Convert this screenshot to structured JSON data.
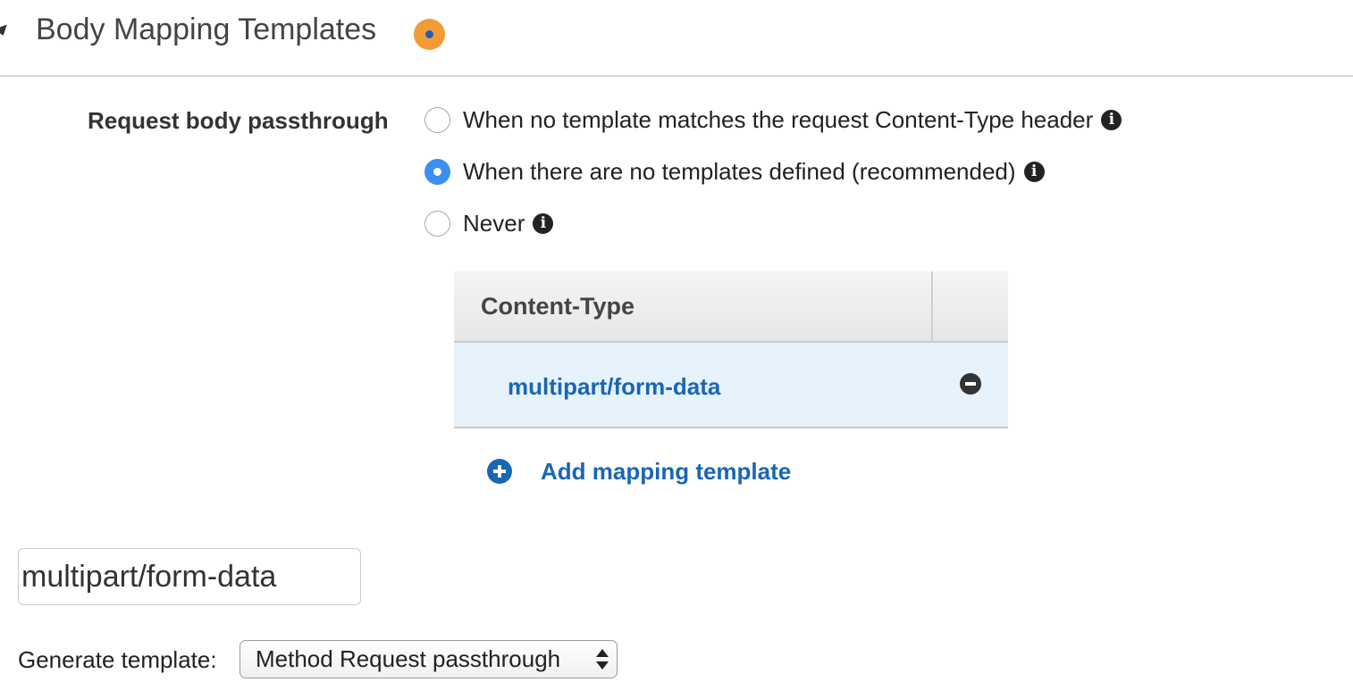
{
  "section": {
    "title": "Body Mapping Templates",
    "status_color": "#f39c37"
  },
  "passthrough": {
    "label": "Request body passthrough",
    "options": [
      {
        "label": "When no template matches the request Content-Type header",
        "selected": false
      },
      {
        "label": "When there are no templates defined (recommended)",
        "selected": true
      },
      {
        "label": "Never",
        "selected": false
      }
    ],
    "info_glyph": "i"
  },
  "table": {
    "header": "Content-Type",
    "rows": [
      {
        "content_type": "multipart/form-data"
      }
    ]
  },
  "add_mapping_label": "Add mapping template",
  "content_type_input": {
    "value": "multipart/form-data"
  },
  "generate_template": {
    "label": "Generate template:",
    "selected": "Method Request passthrough"
  },
  "colors": {
    "link": "#1a66b5",
    "radio_selected": "#3b8ff0",
    "row_highlight": "#e6f2fc"
  }
}
